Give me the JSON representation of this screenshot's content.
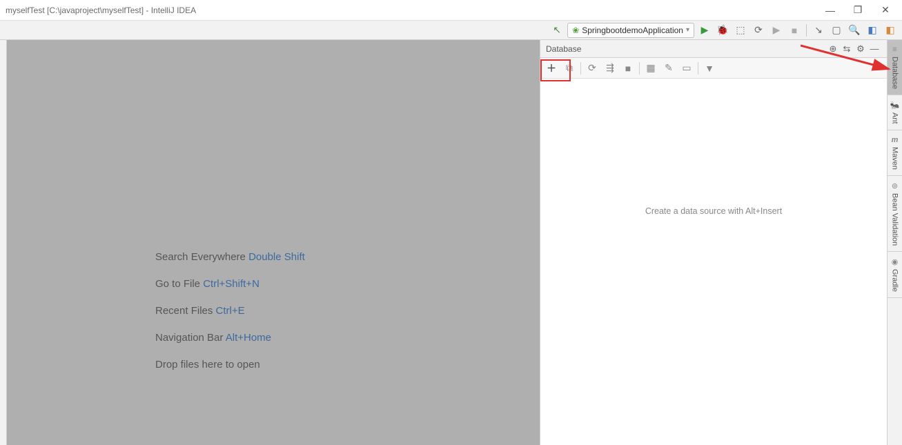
{
  "titlebar": {
    "title": "myselfTest [C:\\javaproject\\myselfTest] - IntelliJ IDEA"
  },
  "toolbar": {
    "run_config": "SpringbootdemoApplication"
  },
  "welcome": {
    "rows": [
      {
        "label": "Search Everywhere ",
        "shortcut": "Double Shift"
      },
      {
        "label": "Go to File ",
        "shortcut": "Ctrl+Shift+N"
      },
      {
        "label": "Recent Files ",
        "shortcut": "Ctrl+E"
      },
      {
        "label": "Navigation Bar ",
        "shortcut": "Alt+Home"
      },
      {
        "label": "Drop files here to open",
        "shortcut": ""
      }
    ]
  },
  "database_panel": {
    "title": "Database",
    "empty_text": "Create a data source with Alt+Insert"
  },
  "side_tabs": {
    "database": "Database",
    "ant": "Ant",
    "maven": "Maven",
    "bean_validation": "Bean Validation",
    "gradle": "Gradle"
  }
}
